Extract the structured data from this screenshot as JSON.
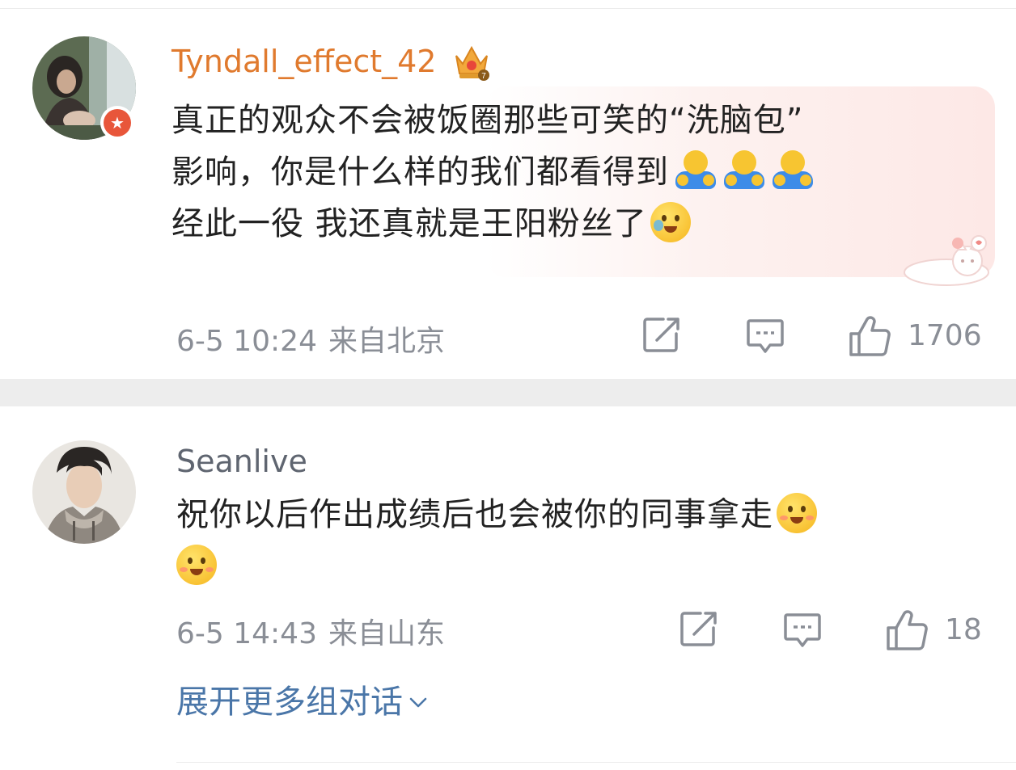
{
  "comments": [
    {
      "username": "Tyndall_effect_42",
      "badge": "crown-icon",
      "verified": "v-badge-icon",
      "lines": [
        "真正的观众不会被饭圈那些可笑的“洗脑包”",
        "影响，你是什么样的我们都看得到",
        "经此一役 我还真就是王阳粉丝了"
      ],
      "date": "6-5 10:24",
      "location": "来自北京",
      "likes": "1706"
    },
    {
      "username": "Seanlive",
      "lines": [
        "祝你以后作出成绩后也会被你的同事拿走"
      ],
      "date": "6-5 14:43",
      "location": "来自山东",
      "likes": "18"
    }
  ],
  "expand_label": "展开更多组对话",
  "colors": {
    "username_vip": "#e07a2e",
    "username": "#5f6570",
    "meta": "#8a8e96",
    "link": "#4a76a8",
    "separator": "#ededed"
  },
  "icons": [
    "repost-icon",
    "comment-icon",
    "like-icon",
    "chevron-down-icon",
    "hug-emoji-icon",
    "smile-emoji-icon"
  ]
}
